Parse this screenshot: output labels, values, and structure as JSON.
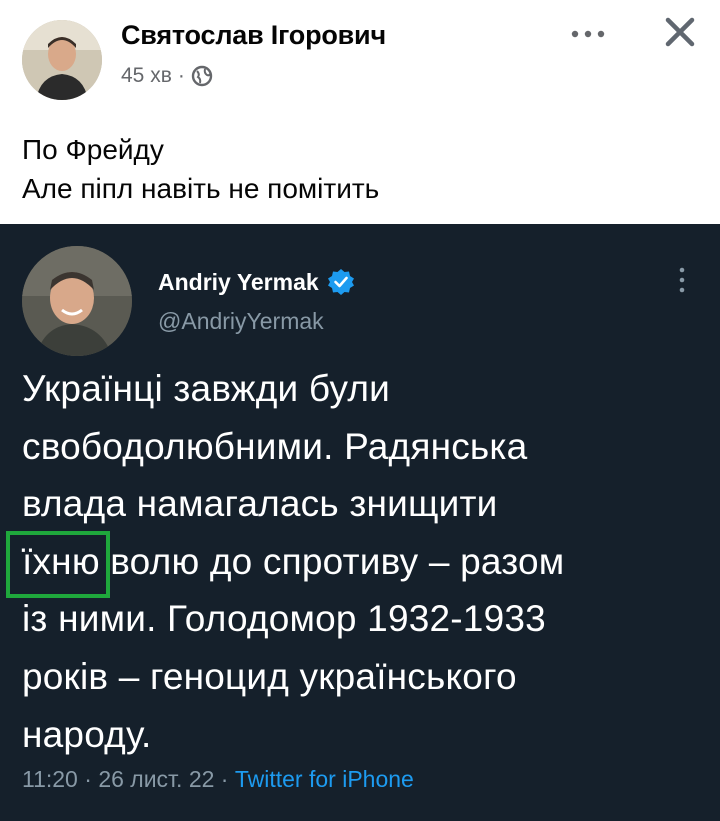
{
  "post": {
    "author": "Святослав Ігорович",
    "time": "45 хв",
    "separator": "·",
    "lines": [
      "По Фрейду",
      "Але піпл навіть не помітить"
    ]
  },
  "tweet": {
    "name": "Andriy Yermak",
    "handle": "@AndriyYermak",
    "lines": [
      "Українці завжди були",
      "свободолюбними. Радянська",
      "влада намагалась знищити"
    ],
    "highlight_word": "їхню",
    "line4_rest": " волю до спротиву – разом",
    "lines_after": [
      "із ними. Голодомор 1932-1933",
      "років – геноцид українського",
      "народу."
    ],
    "time": "11:20",
    "date": "26 лист. 22",
    "sep": "·",
    "source": "Twitter for iPhone"
  },
  "colors": {
    "tweet_bg": "#15202b",
    "verified": "#1d9bf0",
    "highlight_box": "#1fa83c",
    "link": "#1d9bf0"
  },
  "icons": {
    "globe": "globe-icon",
    "more": "more-horizontal-icon",
    "close": "close-icon",
    "verified": "verified-badge-icon",
    "tweet_more": "more-vertical-icon"
  }
}
